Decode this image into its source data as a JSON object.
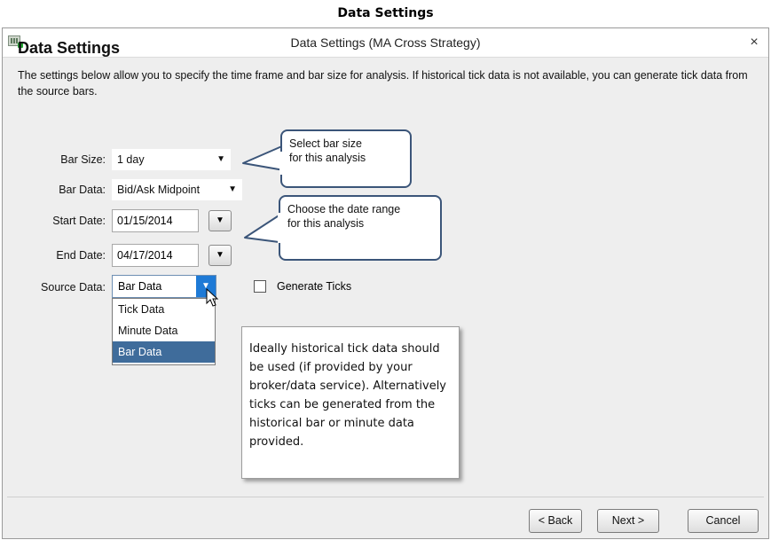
{
  "caption": "Data Settings",
  "window": {
    "title": "Data Settings (MA Cross Strategy)",
    "close_glyph": "×"
  },
  "heading": "Data Settings",
  "description": "The settings below allow you to specify the time frame and bar size for analysis. If historical tick data is not available, you can generate tick data from the source bars.",
  "form": {
    "bar_size": {
      "label": "Bar Size:",
      "value": "1 day"
    },
    "bar_data": {
      "label": "Bar Data:",
      "value": "Bid/Ask Midpoint"
    },
    "start_date": {
      "label": "Start Date:",
      "value": "01/15/2014"
    },
    "end_date": {
      "label": "End Date:",
      "value": "04/17/2014"
    },
    "source_data": {
      "label": "Source Data:",
      "value": "Bar Data",
      "options": [
        "Tick Data",
        "Minute Data",
        "Bar Data"
      ],
      "selected_index": 2
    },
    "generate_ticks": {
      "label": "Generate Ticks",
      "checked": false
    }
  },
  "callouts": {
    "bar_size": "Select bar size\nfor this analysis",
    "date_range": "Choose the date range\nfor this analysis"
  },
  "note": "Ideally historical tick data should be used (if provided by your broker/data service). Alternatively ticks can be generated from the historical bar or minute data provided.",
  "buttons": {
    "back": "< Back",
    "next": "Next >",
    "cancel": "Cancel"
  },
  "icons": {
    "dropdown": "▼",
    "app": "app-icon",
    "cursor": "mouse-pointer-icon"
  },
  "colors": {
    "dropdown_accent": "#1e7ad6",
    "selected_item": "#3f6c9b",
    "callout_border": "#3b5579"
  }
}
